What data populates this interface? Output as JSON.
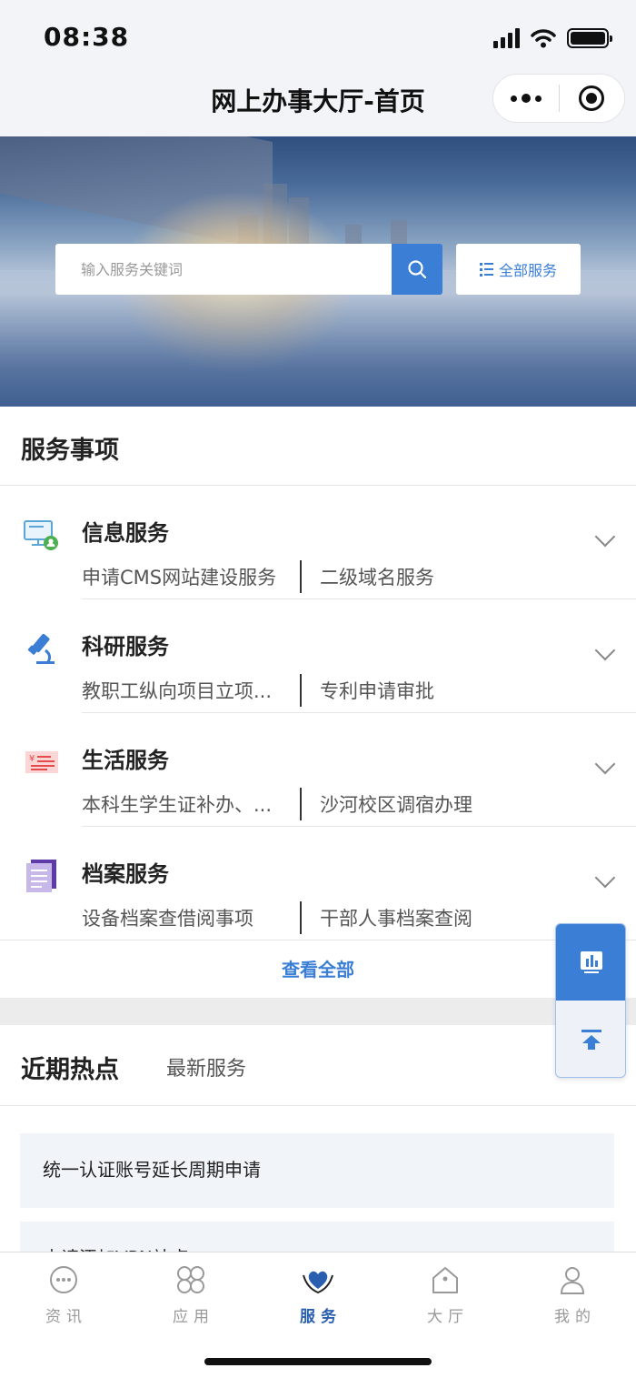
{
  "status_bar": {
    "time": "08:38"
  },
  "nav": {
    "title": "网上办事大厅-首页"
  },
  "search": {
    "placeholder": "输入服务关键词",
    "all_services_label": "全部服务"
  },
  "services_section": {
    "title": "服务事项",
    "items": [
      {
        "name": "信息服务",
        "icon": "computer-user-icon",
        "sub": [
          "申请CMS网站建设服务",
          "二级域名服务"
        ]
      },
      {
        "name": "科研服务",
        "icon": "microscope-icon",
        "sub": [
          "教职工纵向项目立项...",
          "专利申请审批"
        ]
      },
      {
        "name": "生活服务",
        "icon": "yuan-receipt-icon",
        "sub": [
          "本科生学生证补办、...",
          "沙河校区调宿办理"
        ]
      },
      {
        "name": "档案服务",
        "icon": "document-icon",
        "sub": [
          "设备档案查借阅事项",
          "干部人事档案查阅"
        ]
      }
    ],
    "view_all": "查看全部"
  },
  "hot_section": {
    "tabs": [
      "近期热点",
      "最新服务"
    ],
    "items": [
      "统一认证账号延长周期申请",
      "申请添加VPN站点"
    ]
  },
  "tab_bar": {
    "items": [
      {
        "label": "资讯",
        "icon": "chat-bubble-icon",
        "active": false
      },
      {
        "label": "应用",
        "icon": "apps-grid-icon",
        "active": false
      },
      {
        "label": "服务",
        "icon": "heart-hands-icon",
        "active": true
      },
      {
        "label": "大厅",
        "icon": "house-icon",
        "active": false
      },
      {
        "label": "我的",
        "icon": "user-icon",
        "active": false
      }
    ]
  },
  "colors": {
    "accent": "#3a7fd5",
    "active_tab": "#2a5fb0",
    "hot_item_bg": "#f1f4f9"
  }
}
